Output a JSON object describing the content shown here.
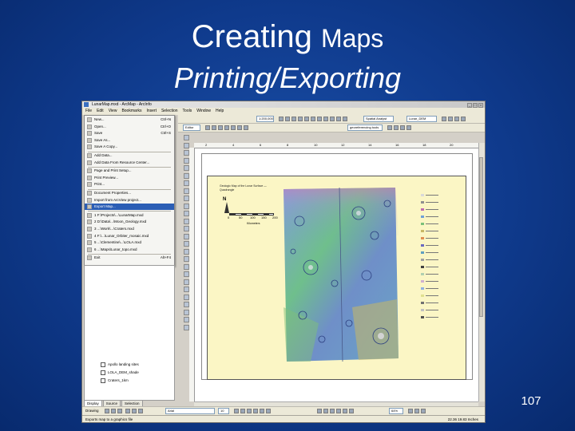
{
  "slide": {
    "title_main": "Creating",
    "title_rest": "Maps",
    "subtitle": "Printing/Exporting",
    "page_number": "107"
  },
  "window": {
    "title": "LunarMap.mxd - ArcMap - ArcInfo",
    "menus": [
      "File",
      "Edit",
      "View",
      "Bookmarks",
      "Insert",
      "Selection",
      "Tools",
      "Window",
      "Help"
    ]
  },
  "file_menu": {
    "items": [
      {
        "label": "New...",
        "shortcut": "Ctrl+N"
      },
      {
        "label": "Open...",
        "shortcut": "Ctrl+O"
      },
      {
        "label": "Save",
        "shortcut": "Ctrl+S"
      },
      {
        "label": "Save As..."
      },
      {
        "label": "Save A Copy..."
      },
      {
        "label": "Add Data..."
      },
      {
        "label": "Add Data From Resource Center..."
      },
      {
        "label": "Page and Print Setup..."
      },
      {
        "label": "Print Preview..."
      },
      {
        "label": "Print..."
      },
      {
        "label": "Document Properties..."
      },
      {
        "label": "Import from ArcView project..."
      },
      {
        "label": "Export Map...",
        "highlighted": true
      },
      {
        "label": "1 F:\\Projects\\...\\LunarMap.mxd"
      },
      {
        "label": "2 D:\\Data\\...\\Moon_Geology.mxd"
      },
      {
        "label": "3 ...\\Work\\...\\Craters.mxd"
      },
      {
        "label": "4 F:\\...\\Lunar_Orbiter_mosaic.mxd"
      },
      {
        "label": "5 ...\\Clementine\\...\\LOLA.mxd"
      },
      {
        "label": "6 ...\\Maps\\Lunar_topo.mxd"
      },
      {
        "label": "Exit",
        "shortcut": "Alt+F4"
      }
    ]
  },
  "toc": {
    "layers": [
      {
        "label": "Apollo landing sites"
      },
      {
        "label": "LOLA_DEM_shade"
      },
      {
        "label": "Craters_1km"
      }
    ],
    "tabs": [
      "Display",
      "Source",
      "Selection"
    ]
  },
  "toolbar": {
    "scale": "1:200,000",
    "editor": "Editor",
    "georef": "georeferencing tools",
    "layer_combo": "Lunar_DEM",
    "spatial_analyst": "Spatial Analyst"
  },
  "layout": {
    "map_title": "Geologic Map of the Lunar Surface — Quadrangle",
    "scale_labels": [
      "0",
      "50",
      "100",
      "150",
      "200"
    ],
    "scale_units": "Kilometers",
    "north_label": "N",
    "ruler_ticks": [
      "2",
      "4",
      "6",
      "8",
      "10",
      "12",
      "14",
      "16",
      "18",
      "20"
    ]
  },
  "bottom_toolbar": {
    "drawing_label": "Drawing",
    "font": "Arial",
    "font_size": "10",
    "zoom": "64%"
  },
  "status": {
    "text": "Exports map to a graphics file",
    "coords": "22.36  19.83 Inches"
  },
  "colors": {
    "slide_background": "#0f3a8c",
    "menu_highlight": "#2b5eb5",
    "map_frame_bg": "#fbf6c5"
  }
}
